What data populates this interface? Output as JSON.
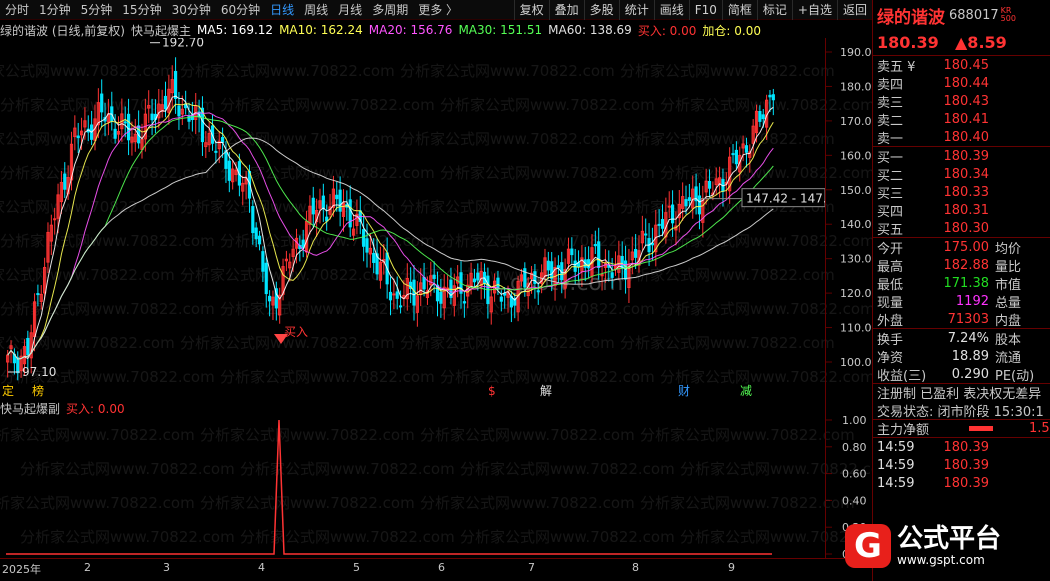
{
  "toolbar": {
    "periods": [
      "分时",
      "1分钟",
      "5分钟",
      "15分钟",
      "30分钟",
      "60分钟",
      "日线",
      "周线",
      "月线",
      "多周期",
      "更多 〉"
    ],
    "active_period": "日线",
    "tools": [
      "复权",
      "叠加",
      "多股",
      "统计",
      "画线",
      "F10",
      "简框",
      "标记",
      "+自选",
      "返回"
    ]
  },
  "legend": {
    "stock": "绿的谐波 (日线,前复权)",
    "indicator": "快马起爆主",
    "ma5": "MA5: 169.12",
    "ma10": "MA10: 162.24",
    "ma20": "MA20: 156.76",
    "ma30": "MA30: 151.51",
    "ma60": "MA60: 138.69",
    "buy": "买入: 0.00",
    "add": "加仓: 0.00"
  },
  "colors": {
    "up": "#ff3333",
    "down": "#00e5ff",
    "ma5": "#ffffff",
    "ma10": "#ffff55",
    "ma20": "#ff55ff",
    "ma30": "#55ff55",
    "ma60": "#e0e0e0",
    "grid": "#600000"
  },
  "main_chart": {
    "high_label": "192.70",
    "low_label": "97.10",
    "cursor_label": "147.42 - 147.",
    "buy_marker": "买入",
    "y_ticks": [
      "190.0",
      "180.0",
      "170.0",
      "160.0",
      "150.0",
      "140.0",
      "130.0",
      "120.0",
      "110.0",
      "100.0"
    ],
    "events": [
      "定",
      "榜",
      "$",
      "解",
      "财",
      "减"
    ],
    "watermark": "分析家公式网www.70822.com",
    "watermark2": "gsptv.com"
  },
  "sub_chart": {
    "title": "快马起爆副",
    "buy": "买入: 0.00",
    "y_ticks": [
      "1.00",
      "0.80",
      "0.60",
      "0.40",
      "0.20",
      "0.00"
    ]
  },
  "x_axis": [
    "2025年",
    "2",
    "3",
    "4",
    "5",
    "6",
    "7",
    "8",
    "9"
  ],
  "quote": {
    "name": "绿的谐波",
    "code": "688017",
    "tag_top": "KR",
    "tag_bottom": "500",
    "price": "180.39",
    "change": "▲8.59",
    "asks": [
      {
        "label": "卖五 ¥",
        "price": "180.45"
      },
      {
        "label": "卖四",
        "price": "180.44"
      },
      {
        "label": "卖三",
        "price": "180.43"
      },
      {
        "label": "卖二",
        "price": "180.41"
      },
      {
        "label": "卖一",
        "price": "180.40"
      }
    ],
    "bids": [
      {
        "label": "买一",
        "price": "180.39"
      },
      {
        "label": "买二",
        "price": "180.34"
      },
      {
        "label": "买三",
        "price": "180.33"
      },
      {
        "label": "买四",
        "price": "180.31"
      },
      {
        "label": "买五",
        "price": "180.30"
      }
    ],
    "stats": [
      {
        "l1": "今开",
        "v1": "175.00",
        "l2": "均价",
        "c": "red"
      },
      {
        "l1": "最高",
        "v1": "182.88",
        "l2": "量比",
        "c": "red"
      },
      {
        "l1": "最低",
        "v1": "171.38",
        "l2": "市值",
        "c": "green"
      },
      {
        "l1": "现量",
        "v1": "1192",
        "l2": "总量",
        "c": "purple"
      },
      {
        "l1": "外盘",
        "v1": "71303",
        "l2": "内盘",
        "c": "red"
      }
    ],
    "fund": [
      {
        "l1": "换手",
        "v1": "7.24%",
        "l2": "股本"
      },
      {
        "l1": "净资",
        "v1": "18.89",
        "l2": "流通"
      },
      {
        "l1": "收益(三)",
        "v1": "0.290",
        "l2": "PE(动)"
      }
    ],
    "flags": "注册制 已盈利 表决权无差异",
    "trade_status": "交易状态: 闭市阶段 15:30:1",
    "main_flow_label": "主力净额",
    "main_flow_value": "1.5",
    "ticks": [
      {
        "time": "14:59",
        "price": "180.39"
      },
      {
        "time": "14:59",
        "price": "180.39"
      },
      {
        "time": "14:59",
        "price": "180.39"
      }
    ]
  },
  "logo": {
    "badge": "G",
    "title": "公式平台",
    "url": "www.gspt.com"
  }
}
